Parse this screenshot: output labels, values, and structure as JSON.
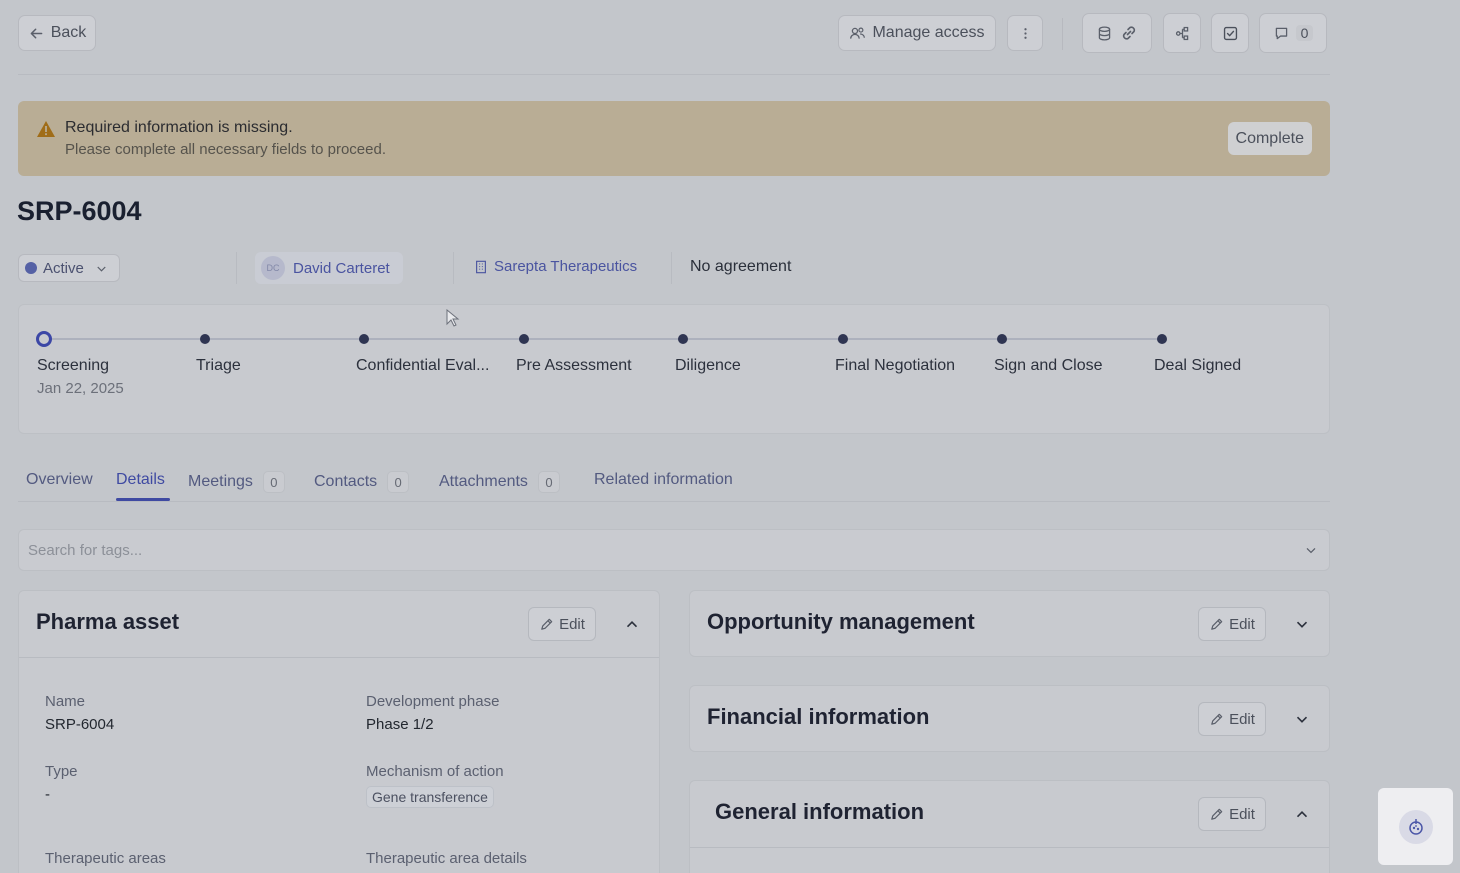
{
  "header": {
    "back_label": "Back",
    "manage_access_label": "Manage access",
    "comment_count": "0"
  },
  "banner": {
    "title": "Required information is missing.",
    "message": "Please complete all necessary fields to proceed.",
    "action_label": "Complete"
  },
  "record": {
    "title": "SRP-6004",
    "status": "Active",
    "owner_initials": "DC",
    "owner_name": "David Carteret",
    "company": "Sarepta Therapeutics",
    "agreement": "No agreement"
  },
  "stages": {
    "items": [
      {
        "label": "Screening"
      },
      {
        "label": "Triage"
      },
      {
        "label": "Confidential Eval..."
      },
      {
        "label": "Pre Assessment"
      },
      {
        "label": "Diligence"
      },
      {
        "label": "Final Negotiation"
      },
      {
        "label": "Sign and Close"
      },
      {
        "label": "Deal Signed"
      }
    ],
    "current_date": "Jan 22, 2025"
  },
  "tabs": [
    {
      "label": "Overview"
    },
    {
      "label": "Details"
    },
    {
      "label": "Meetings",
      "count": "0"
    },
    {
      "label": "Contacts",
      "count": "0"
    },
    {
      "label": "Attachments",
      "count": "0"
    },
    {
      "label": "Related information"
    }
  ],
  "search": {
    "placeholder": "Search for tags..."
  },
  "pharma_asset": {
    "title": "Pharma asset",
    "edit_label": "Edit",
    "fields": {
      "name_label": "Name",
      "name_value": "SRP-6004",
      "phase_label": "Development phase",
      "phase_value": "Phase 1/2",
      "type_label": "Type",
      "type_value": "-",
      "moa_label": "Mechanism of action",
      "moa_value": "Gene transference",
      "ta_label": "Therapeutic areas",
      "ta_details_label": "Therapeutic area details"
    }
  },
  "opportunity": {
    "title": "Opportunity management",
    "edit_label": "Edit"
  },
  "financial": {
    "title": "Financial information",
    "edit_label": "Edit"
  },
  "general": {
    "title": "General information",
    "edit_label": "Edit"
  }
}
